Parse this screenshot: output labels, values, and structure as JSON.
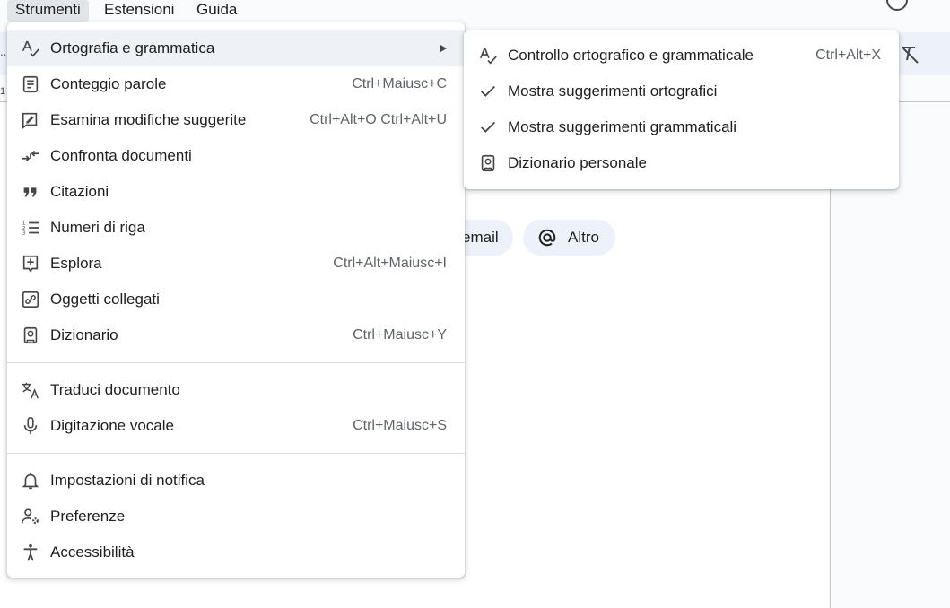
{
  "menubar": {
    "items": [
      "Strumenti",
      "Estensioni",
      "Guida"
    ],
    "active": "Strumenti"
  },
  "ruler": {
    "dots": "..",
    "one": "1"
  },
  "chips": {
    "email_label": "email",
    "altro_label": "Altro"
  },
  "tools_menu": {
    "items": [
      {
        "label": "Ortografia e grammatica",
        "shortcut": "",
        "icon": "spellcheck-icon",
        "has_submenu": true
      },
      {
        "label": "Conteggio parole",
        "shortcut": "Ctrl+Maiusc+C",
        "icon": "word-count-icon"
      },
      {
        "label": "Esamina modifiche suggerite",
        "shortcut": "Ctrl+Alt+O Ctrl+Alt+U",
        "icon": "review-edits-icon"
      },
      {
        "label": "Confronta documenti",
        "shortcut": "",
        "icon": "compare-icon"
      },
      {
        "label": "Citazioni",
        "shortcut": "",
        "icon": "quote-icon"
      },
      {
        "label": "Numeri di riga",
        "shortcut": "",
        "icon": "line-numbers-icon"
      },
      {
        "label": "Esplora",
        "shortcut": "Ctrl+Alt+Maiusc+I",
        "icon": "explore-icon"
      },
      {
        "label": "Oggetti collegati",
        "shortcut": "",
        "icon": "linked-objects-icon"
      },
      {
        "label": "Dizionario",
        "shortcut": "Ctrl+Maiusc+Y",
        "icon": "dictionary-icon"
      },
      {
        "label": "Traduci documento",
        "shortcut": "",
        "icon": "translate-icon"
      },
      {
        "label": "Digitazione vocale",
        "shortcut": "Ctrl+Maiusc+S",
        "icon": "microphone-icon"
      },
      {
        "label": "Impostazioni di notifica",
        "shortcut": "",
        "icon": "bell-icon"
      },
      {
        "label": "Preferenze",
        "shortcut": "",
        "icon": "preferences-icon"
      },
      {
        "label": "Accessibilità",
        "shortcut": "",
        "icon": "accessibility-icon"
      }
    ]
  },
  "spelling_submenu": {
    "items": [
      {
        "label": "Controllo ortografico e grammaticale",
        "shortcut": "Ctrl+Alt+X",
        "icon": "spellcheck-icon"
      },
      {
        "label": "Mostra suggerimenti ortografici",
        "shortcut": "",
        "icon": "check-icon",
        "checked": true
      },
      {
        "label": "Mostra suggerimenti grammaticali",
        "shortcut": "",
        "icon": "check-icon",
        "checked": true
      },
      {
        "label": "Dizionario personale",
        "shortcut": "",
        "icon": "dictionary-icon"
      }
    ]
  },
  "colors": {
    "menu_bg": "#ffffff",
    "hover_bg": "#eef2f6",
    "text": "#1f1f1f",
    "shortcut_text": "#5f6368",
    "toolbar_bg": "#edf2fa"
  }
}
